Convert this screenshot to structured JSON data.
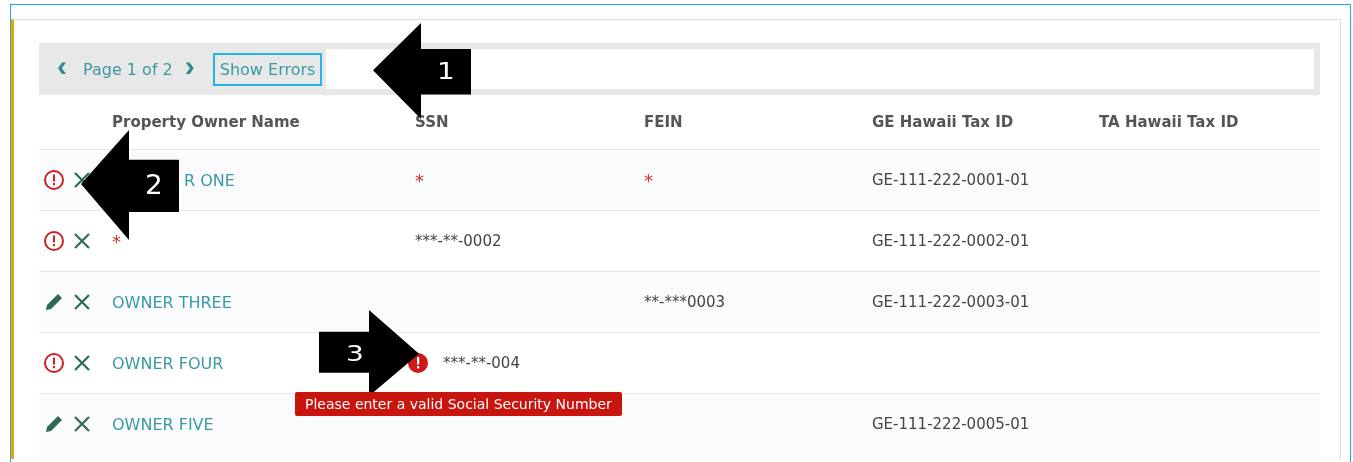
{
  "toolbar": {
    "prev": "‹",
    "page_label": "Page 1 of 2",
    "next": "›",
    "show_errors": {
      "label": "Show Errors",
      "focused": true
    }
  },
  "columns": [
    "Property Owner Name",
    "SSN",
    "FEIN",
    "GE Hawaii Tax ID",
    "TA Hawaii Tax ID"
  ],
  "rows": [
    {
      "kind": "error",
      "name": {
        "text": "R ONE",
        "required": false
      },
      "ssn": {
        "text": "*",
        "required": true
      },
      "fein": {
        "text": "*",
        "required": true
      },
      "ge": "GE-111-222-0001-01"
    },
    {
      "kind": "error",
      "name": {
        "text": "*",
        "required": true
      },
      "ssn": {
        "text": "***-**-0002",
        "required": false
      },
      "ge": "GE-111-222-0002-01"
    },
    {
      "kind": "ok",
      "name": {
        "text": "OWNER THREE",
        "required": false
      },
      "fein": {
        "text": "**-***0003",
        "required": false
      },
      "ge": "GE-111-222-0003-01"
    },
    {
      "kind": "error",
      "name": {
        "text": "OWNER FOUR",
        "required": false
      },
      "ssn": {
        "text": "***-**-004",
        "required": false,
        "error": "Please enter a valid Social Security Number"
      }
    },
    {
      "kind": "ok",
      "name": {
        "text": "OWNER FIVE",
        "required": false
      },
      "ge": "GE-111-222-0005-01"
    }
  ],
  "callouts": [
    {
      "number": "1",
      "kind": "left"
    },
    {
      "number": "2",
      "kind": "left"
    },
    {
      "number": "3",
      "kind": "right"
    }
  ]
}
